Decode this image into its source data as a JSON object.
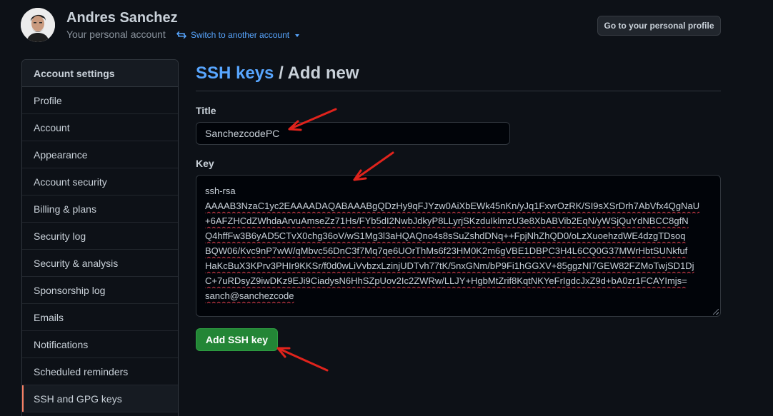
{
  "header": {
    "user_name": "Andres Sanchez",
    "account_type": "Your personal account",
    "switch_account_label": "Switch to another account",
    "profile_button_label": "Go to your personal profile"
  },
  "sidebar": {
    "heading": "Account settings",
    "items": [
      {
        "label": "Profile"
      },
      {
        "label": "Account"
      },
      {
        "label": "Appearance"
      },
      {
        "label": "Account security"
      },
      {
        "label": "Billing & plans"
      },
      {
        "label": "Security log"
      },
      {
        "label": "Security & analysis"
      },
      {
        "label": "Sponsorship log"
      },
      {
        "label": "Emails"
      },
      {
        "label": "Notifications"
      },
      {
        "label": "Scheduled reminders"
      },
      {
        "label": "SSH and GPG keys",
        "active": true
      }
    ]
  },
  "main": {
    "breadcrumb_link": "SSH keys",
    "breadcrumb_separator": " / ",
    "page_title": "Add new",
    "title_label": "Title",
    "title_value": "SanchezcodePC",
    "key_label": "Key",
    "key_lines": [
      "ssh-rsa",
      "AAAAB3NzaC1yc2EAAAADAQABAAABgQDzHy9qFJYzw0AiXbEWk45nKn/yJq1FxvrOzRK/SI9sXSrDrh7AbVfx4QgNaU",
      "+6AFZHCdZWhdaArvuAmseZz71Hs/FYb5dI2NwbJdkyP8LLyrjSKzduIklmzU3e8XbABVib2EqN/yWSjQuYdNBCC8gfN",
      "Q4hffFw3B6yAD5CTvX0chg36oV/wS1Mg3l3aHQAQno4s8sSuZshdDNq++FpjNhZhQD0/oLzXuoehzdWE4dzgTDsoq",
      "BQW06/Kvc9nP7wW/qMbvc56DnC3f7Mq7qe6UOrThMs6f23HM0K2m6gVBE1DBPC3H4L6CQ0G37MWrHbtSUNkfuf",
      "HaKcBuX3KPrv3PHIr9KKSr/f0d0wLiVvbzxLzinjUDTvh77tK/5nxGNm/bP9Fi1hGGXV+85ggzNI7GEW82FZMoTwjSD1Dj",
      "C+7uRDsyZ9iwDKz9EJi9CiadysN6HhSZpUov2Ic2ZWRw/LLJY+HgbMtZrif8KqtNKYeFrIgdcJxZ9d+bA0zr1FCAYImjs=",
      "sanch@sanchezcode"
    ],
    "submit_label": "Add SSH key"
  },
  "annotations": {
    "arrow_color": "#e0231c"
  }
}
